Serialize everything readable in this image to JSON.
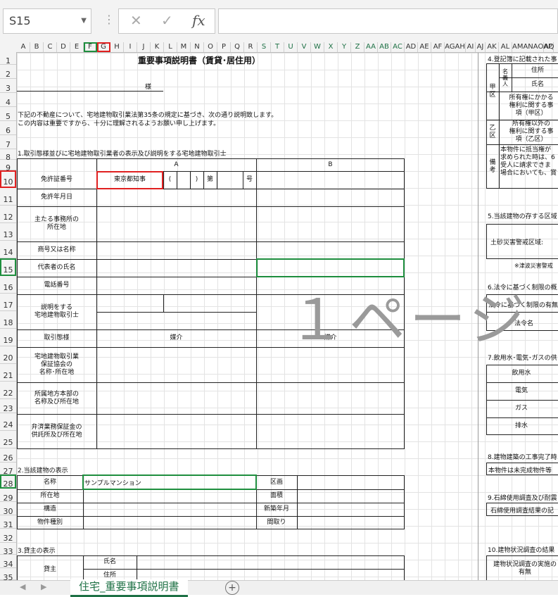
{
  "toolbar": {
    "name_box": "S15",
    "fx_label": "fx",
    "cancel": "✕",
    "confirm": "✓"
  },
  "columns": [
    "A",
    "B",
    "C",
    "D",
    "E",
    "F",
    "G",
    "H",
    "I",
    "J",
    "K",
    "L",
    "M",
    "N",
    "O",
    "P",
    "Q",
    "R",
    "S",
    "T",
    "U",
    "V",
    "W",
    "X",
    "Y",
    "Z",
    "AA",
    "AB",
    "AC",
    "AD",
    "AE",
    "AF",
    "AGAH",
    "AI",
    "AJ",
    "AK",
    "AL",
    "AMANAOAP",
    "AQ"
  ],
  "rows": [
    "1",
    "2",
    "3",
    "4",
    "5",
    "6",
    "7",
    "8",
    "9",
    "10",
    "11",
    "12",
    "13",
    "14",
    "15",
    "16",
    "17",
    "18",
    "19",
    "20",
    "21",
    "22",
    "23",
    "24",
    "25",
    "26",
    "27",
    "28",
    "29",
    "30",
    "31",
    "32",
    "33",
    "34",
    "35"
  ],
  "doc": {
    "title": "重要事項説明書（賃貸･居住用）",
    "sama": "様",
    "intro1": "下記の不動産について、宅地建物取引業法第35条の規定に基づき、次の通り説明致します。",
    "intro2": "この内容は重要ですから、十分に理解されるようお願い申し上げます。",
    "sec1": "1.取引態様並びに宅地建物取引業者の表示及び説明をする宅地建物取引士",
    "colA": "A",
    "colB": "B",
    "license_no": "免許証番号",
    "license_val": "東京都知事",
    "paren_open": "(",
    "paren_close": ")",
    "dai": "第",
    "go": "号",
    "license_date": "免許年月日",
    "main_office": "主たる事務所の\n所在地",
    "trade_name": "商号又は名称",
    "rep_name": "代表者の氏名",
    "phone": "電話番号",
    "agent": "説明をする\n宅地建物取引士",
    "trans_type": "取引態様",
    "baikai_a": "媒介",
    "baikai_b": "媒介",
    "assoc": "宅地建物取引業\n保証協会の\n名称･所在地",
    "regional": "所属地方本部の\n名称及び所在地",
    "deposit": "弁済業務保証金の\n供託所及び所在地",
    "sec2": "2.当該建物の表示",
    "name": "名称",
    "name_val": "サンプルマンション",
    "kukaku": "区画",
    "address": "所在地",
    "area": "面積",
    "structure": "構造",
    "built": "新築年月",
    "type": "物件種別",
    "layout": "間取り",
    "sec3": "3.貸主の表示",
    "lessor": "貸主",
    "shimei": "氏名",
    "jusho": "住所"
  },
  "right": {
    "sec4": "4.登記簿に記載された事",
    "meigi": "名\n義\n人",
    "jusho": "住所",
    "shimei": "氏名",
    "ko": "甲\n区",
    "ko_text": "所有権にかかる\n権利に関する事\n項（甲区）",
    "otsu": "乙\n区",
    "otsu_text": "所有権以外の\n権利に関する事\n項（乙区）",
    "biko": "備\n考",
    "biko_text": "本物件に抵当権が\n求められた時は、6\n受人に請求できま\n場合においても、賞",
    "sec5": "5.当該建物の存する区域",
    "dosha": "土砂災害警戒区域:",
    "tsunami": "※津波災害警戒",
    "sec6": "6.法令に基づく制限の概",
    "law": "法令に基づく制限の有無",
    "law_name": "法令名",
    "sec7": "7.飲用水･電気･ガスの供",
    "water": "飲用水",
    "elec": "電気",
    "gas": "ガス",
    "drain": "排水",
    "sec8": "8.建物建築の工事完了時",
    "mikansei": "本物件は未完成物件等",
    "sec9": "9.石綿使用調査及び耐震",
    "asbestos": "石綿使用調査結果の記",
    "sec10": "10.建物状況調査の結果",
    "inspection": "建物状況調査の実施の\n有無"
  },
  "watermark": "１ページ",
  "sheet_tab": "住宅_重要事項説明書",
  "add_tab": "+"
}
